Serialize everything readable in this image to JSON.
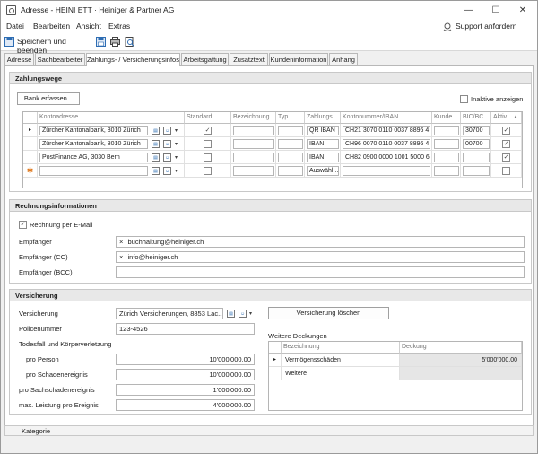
{
  "window": {
    "title": "Adresse - HEINI ETT · Heiniger & Partner AG",
    "minimize": "—",
    "maximize": "☐",
    "close": "✕"
  },
  "menu": {
    "items": [
      "Datei",
      "Bearbeiten",
      "Ansicht",
      "Extras"
    ],
    "support": "Support anfordern"
  },
  "toolbar": {
    "save_close": "Speichern und beenden"
  },
  "tabs": [
    "Adresse",
    "Sachbearbeiter",
    "Zahlungs- / Versicherungsinfos",
    "Arbeitsgattung",
    "Zusatztext",
    "Kundeninformation",
    "Anhang"
  ],
  "active_tab": 2,
  "zahlungswege": {
    "title": "Zahlungswege",
    "bank_button": "Bank erfassen...",
    "inactive_label": "Inaktive anzeigen",
    "columns": [
      "Kontoadresse",
      "Standard",
      "Bezeichnung",
      "Typ",
      "Zahlungs...",
      "Kontonummer/IBAN",
      "Kunde...",
      "BIC/BC...",
      "Aktiv"
    ],
    "rows": [
      {
        "address": "Zürcher Kantonalbank, 8010 Zürich",
        "standard": "✓",
        "payment": "QR IBAN",
        "iban": "CH21 3070 0110 0037 8896 4",
        "bc": "30700",
        "active": "✓"
      },
      {
        "address": "Zürcher Kantonalbank, 8010 Zürich",
        "standard": "",
        "payment": "IBAN",
        "iban": "CH96 0070 0110 0037 8896 4",
        "bc": "00700",
        "active": "✓"
      },
      {
        "address": "PostFinance AG, 3030 Bern",
        "standard": "",
        "payment": "IBAN",
        "iban": "CH82 0900 0000 1001 5000 6",
        "bc": "",
        "active": "✓"
      }
    ],
    "new_row_payment": "Auswähl..."
  },
  "rechnung": {
    "title": "Rechnungsinformationen",
    "email_label": "Rechnung per E-Mail",
    "email_checked": "✓",
    "empfaenger_label": "Empfänger",
    "empfaenger_value": "buchhaltung@heiniger.ch",
    "cc_label": "Empfänger (CC)",
    "cc_value": "info@heiniger.ch",
    "bcc_label": "Empfänger (BCC)",
    "remove_symbol": "×"
  },
  "versicherung": {
    "title": "Versicherung",
    "versicherung_label": "Versicherung",
    "versicherung_value": "Zürich Versicherungen, 8853 Lac...",
    "delete_button": "Versicherung löschen",
    "police_label": "Policenummer",
    "police_value": "123-4526",
    "todesfall_label": "Todesfall und Körperverletzung",
    "pro_person_label": "pro Person",
    "pro_person_value": "10'000'000.00",
    "pro_schaden_label": "pro Schadenereignis",
    "pro_schaden_value": "10'000'000.00",
    "sach_label": "pro Sachschadenereignis",
    "sach_value": "1'000'000.00",
    "max_label": "max. Leistung pro Ereignis",
    "max_value": "4'000'000.00",
    "weitere_title": "Weitere Deckungen",
    "weitere_columns": [
      "Bezeichnung",
      "Deckung"
    ],
    "weitere_rows": [
      {
        "name": "Vermögensschäden",
        "value": "5'000'000.00"
      },
      {
        "name": "Weitere",
        "value": ""
      }
    ]
  },
  "status": {
    "kategorie": "Kategorie"
  }
}
